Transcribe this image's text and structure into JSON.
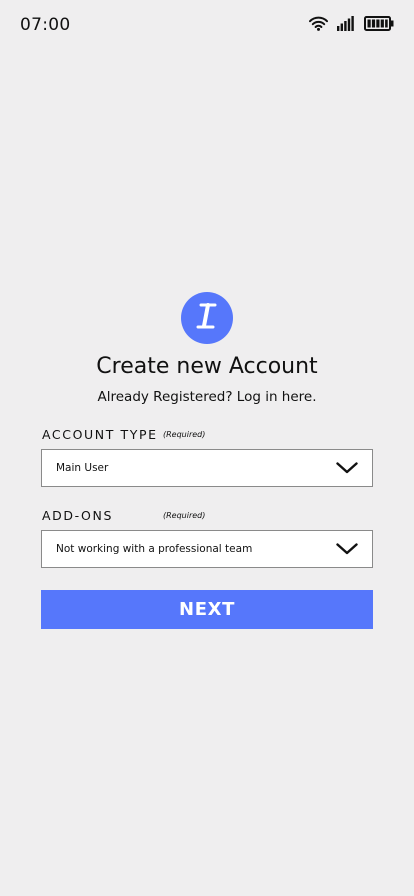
{
  "status_bar": {
    "time": "07:00",
    "icons": [
      "wifi-icon",
      "signal-icon",
      "battery-icon"
    ]
  },
  "logo": {
    "icon": "pen-logo-icon",
    "color": "#5677fb"
  },
  "header": {
    "title": "Create new Account",
    "subtitle": "Already Registered? Log in here."
  },
  "form": {
    "account_type": {
      "label": "ACCOUNT TYPE",
      "required": "(Required)",
      "value": "Main User"
    },
    "add_ons": {
      "label": "ADD-ONS",
      "required": "(Required)",
      "value": "Not working with a professional team"
    },
    "next_label": "NEXT"
  },
  "colors": {
    "accent": "#5677fb",
    "background": "#efeeef"
  }
}
